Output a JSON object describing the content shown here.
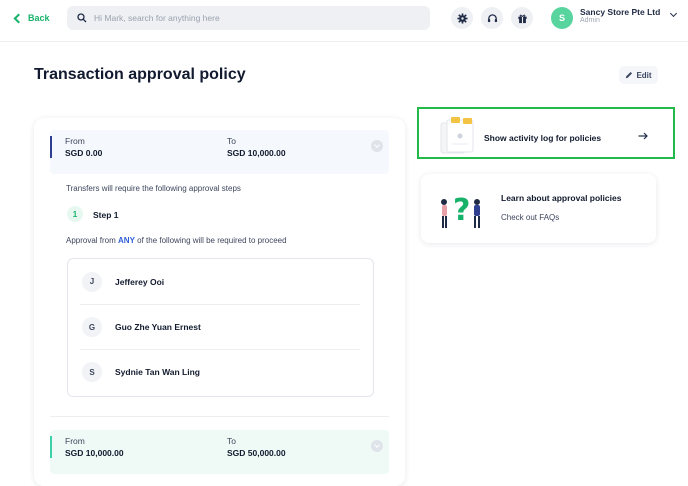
{
  "header": {
    "back_label": "Back",
    "search_placeholder": "Hi Mark, search for anything here",
    "icons": [
      "gear-icon",
      "headset-icon",
      "gift-icon"
    ],
    "avatar_initial": "S",
    "org_name": "Sancy Store Pte Ltd",
    "org_role": "Admin"
  },
  "page": {
    "title": "Transaction approval policy",
    "edit_label": "Edit"
  },
  "policy": {
    "range1": {
      "from_label": "From",
      "from_value": "SGD 0.00",
      "to_label": "To",
      "to_value": "SGD 10,000.00"
    },
    "steps_intro": "Transfers will require the following approval steps",
    "step_number": "1",
    "step_label": "Step 1",
    "approval_prefix": "Approval from ",
    "approval_any": "ANY",
    "approval_suffix": " of the following will be required to proceed",
    "approvers": [
      {
        "initial": "J",
        "name": "Jefferey Ooi"
      },
      {
        "initial": "G",
        "name": "Guo Zhe Yuan Ernest"
      },
      {
        "initial": "S",
        "name": "Sydnie Tan Wan Ling"
      }
    ],
    "range2": {
      "from_label": "From",
      "from_value": "SGD 10,000.00",
      "to_label": "To",
      "to_value": "SGD 50,000.00"
    }
  },
  "cards": {
    "activity_label": "Show activity log for policies",
    "learn_title": "Learn about approval policies",
    "learn_sub": "Check out FAQs"
  },
  "colors": {
    "accent_green": "#17b26a",
    "highlight_border": "#22bb4a",
    "any_blue": "#2f5fd6"
  }
}
